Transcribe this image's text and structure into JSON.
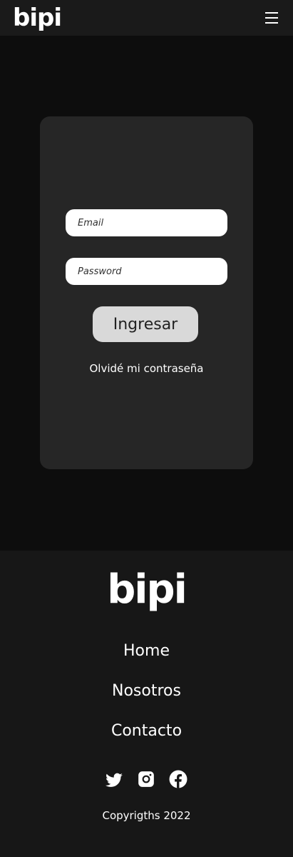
{
  "header": {
    "logo": "bipi",
    "menu_icon": "hamburger-menu-icon"
  },
  "login": {
    "email_placeholder": "Email",
    "password_placeholder": "Password",
    "submit_label": "Ingresar",
    "forgot_label": "Olvidé mi contraseña"
  },
  "footer": {
    "logo": "bipi",
    "nav": [
      {
        "label": "Home"
      },
      {
        "label": "Nosotros"
      },
      {
        "label": "Contacto"
      }
    ],
    "social": [
      {
        "icon": "twitter-icon"
      },
      {
        "icon": "instagram-icon"
      },
      {
        "icon": "facebook-icon"
      }
    ],
    "copyright": "Copyrigths 2022"
  },
  "colors": {
    "page_bg": "#0d0d0d",
    "header_bg": "#1a1a1a",
    "card_bg": "#262626",
    "button_bg": "#d9d9d9",
    "footer_bg": "#171717"
  }
}
